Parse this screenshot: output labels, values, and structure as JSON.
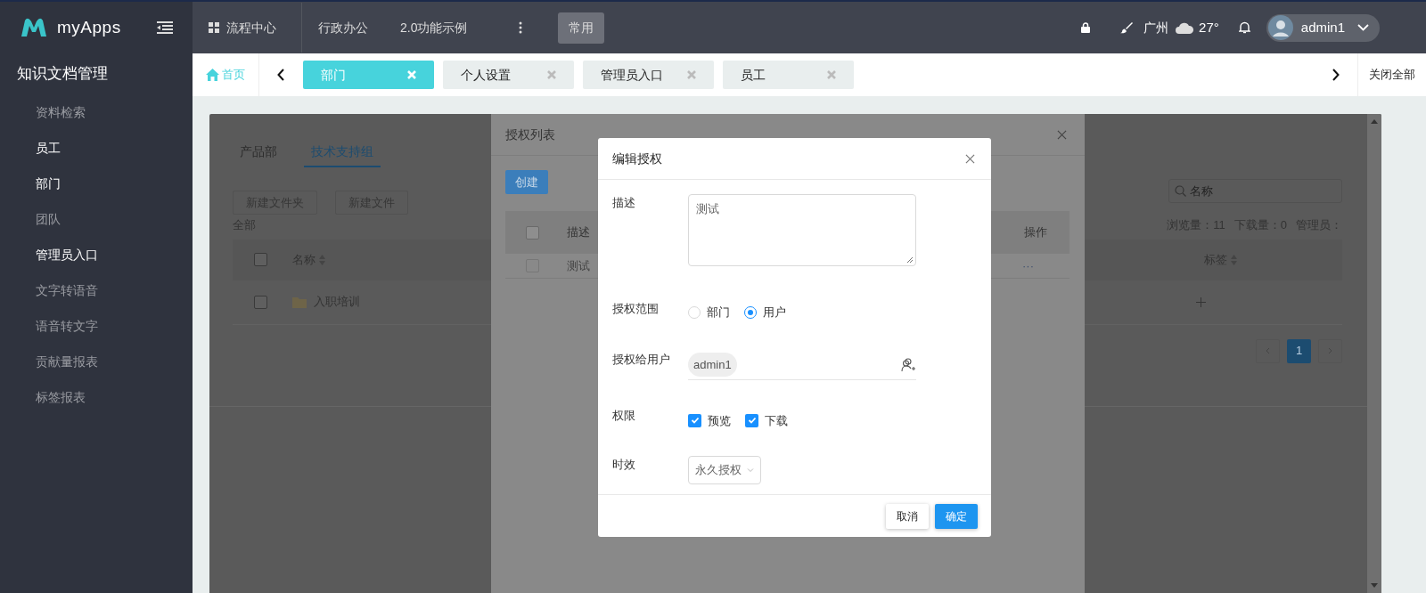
{
  "header": {
    "logo_text": "myApps",
    "nav": [
      {
        "label": "流程中心",
        "kind": "grid",
        "selected": false
      },
      {
        "label": "行政办公",
        "kind": "plain",
        "selected": false
      },
      {
        "label": "2.0功能示例",
        "kind": "plain",
        "selected": false
      },
      {
        "label": "常用",
        "kind": "plain",
        "selected": true
      }
    ],
    "city": "广州",
    "temperature": "27°",
    "user": "admin1"
  },
  "sidebar": {
    "title": "知识文档管理",
    "items": [
      {
        "label": "资料检索",
        "highlighted": false
      },
      {
        "label": "员工",
        "highlighted": true
      },
      {
        "label": "部门",
        "highlighted": true
      },
      {
        "label": "团队",
        "highlighted": false
      },
      {
        "label": "管理员入口",
        "highlighted": true
      },
      {
        "label": "文字转语音",
        "highlighted": false
      },
      {
        "label": "语音转文字",
        "highlighted": false
      },
      {
        "label": "贡献量报表",
        "highlighted": false
      },
      {
        "label": "标签报表",
        "highlighted": false
      }
    ]
  },
  "tab_bar": {
    "home": "首页",
    "tabs": [
      {
        "label": "部门",
        "selected": true
      },
      {
        "label": "个人设置",
        "selected": false
      },
      {
        "label": "管理员入口",
        "selected": false
      },
      {
        "label": "员工",
        "selected": false
      }
    ],
    "close_all": "关闭全部"
  },
  "page": {
    "group_tabs": [
      {
        "label": "产品部",
        "selected": false
      },
      {
        "label": "技术支持组",
        "selected": true
      }
    ],
    "buttons": [
      "新建文件夹",
      "新建文件"
    ],
    "breadcrumb": "全部",
    "search": {
      "placeholder": "名称"
    },
    "stats": [
      "浏览量：11",
      "下载量：0",
      "管理员："
    ],
    "table": {
      "all_checked": false,
      "columns": [
        "名称",
        "标签"
      ],
      "rows": [
        {
          "name": "入职培训",
          "checked": false
        }
      ]
    },
    "pagination": [
      {
        "label": "1",
        "selected": true
      }
    ]
  },
  "list_modal": {
    "title": "授权列表",
    "create": "创建",
    "all_checked": false,
    "columns": [
      "描述",
      "操作"
    ],
    "rows": [
      {
        "description": "测试",
        "action": "···",
        "checked": false
      }
    ]
  },
  "dialog": {
    "title": "编辑授权",
    "fields": [
      {
        "kind": "textarea",
        "label": "描述",
        "value": "测试"
      },
      {
        "kind": "radio",
        "label": "授权范围",
        "options": [
          {
            "label": "部门",
            "selected": false
          },
          {
            "label": "用户",
            "selected": true
          }
        ]
      },
      {
        "kind": "users",
        "label": "授权给用户",
        "users": [
          "admin1"
        ]
      },
      {
        "kind": "checkbox",
        "label": "权限",
        "options": [
          {
            "label": "预览",
            "checked": true
          },
          {
            "label": "下载",
            "checked": true
          }
        ]
      },
      {
        "kind": "select",
        "label": "时效",
        "value": "永久授权"
      }
    ],
    "cancel": "取消",
    "ok": "确定"
  }
}
